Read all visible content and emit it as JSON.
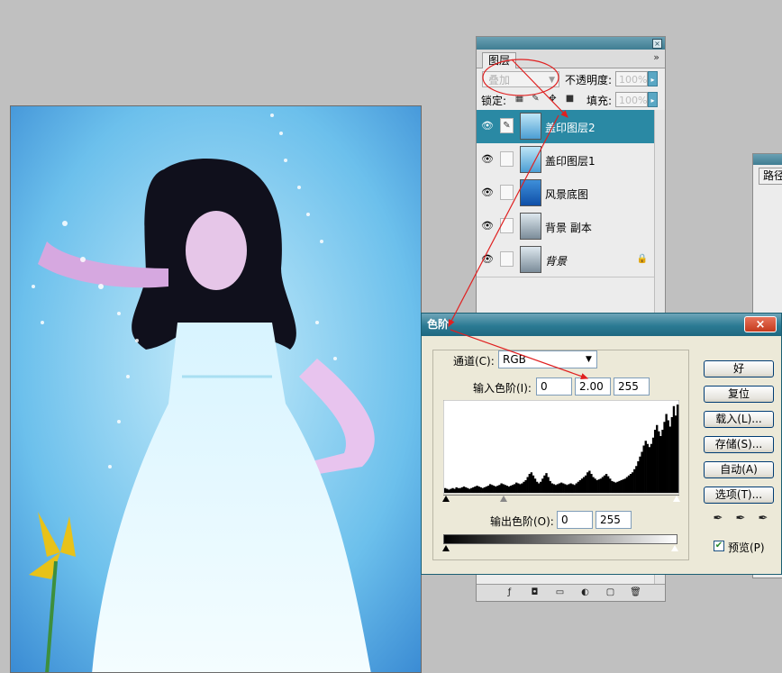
{
  "layers_panel": {
    "tab_label": "图层",
    "menu_glyph": "»",
    "close_glyph": "×",
    "blend_mode": "叠加",
    "opacity_label": "不透明度:",
    "opacity_value": "100%",
    "lock_label": "锁定:",
    "fill_label": "填充:",
    "fill_value": "100%",
    "layers": [
      {
        "name": "盖印图层2",
        "selected": true,
        "visible": true,
        "locked": false,
        "italic": false
      },
      {
        "name": "盖印图层1",
        "selected": false,
        "visible": true,
        "locked": false,
        "italic": false
      },
      {
        "name": "风景底图",
        "selected": false,
        "visible": true,
        "locked": false,
        "italic": false
      },
      {
        "name": "背景 副本",
        "selected": false,
        "visible": true,
        "locked": false,
        "italic": false
      },
      {
        "name": "背景",
        "selected": false,
        "visible": true,
        "locked": true,
        "italic": true
      }
    ]
  },
  "paths_panel": {
    "tab_label": "路径"
  },
  "levels_dialog": {
    "title": "色阶",
    "close_glyph": "×",
    "channel_label": "通道(C):",
    "channel_value": "RGB",
    "input_label": "输入色阶(I):",
    "input_black": "0",
    "input_gamma": "2.00",
    "input_white": "255",
    "output_label": "输出色阶(O):",
    "output_black": "0",
    "output_white": "255",
    "buttons": {
      "ok": "好",
      "reset": "复位",
      "load": "载入(L)...",
      "save": "存储(S)...",
      "auto": "自动(A)",
      "options": "选项(T)..."
    },
    "preview_label": "预览(P)",
    "preview_checked": true,
    "histogram": [
      6,
      5,
      4,
      5,
      6,
      5,
      7,
      6,
      6,
      7,
      8,
      7,
      6,
      5,
      6,
      7,
      8,
      9,
      8,
      7,
      6,
      7,
      8,
      9,
      11,
      10,
      9,
      8,
      9,
      10,
      12,
      11,
      10,
      9,
      8,
      9,
      10,
      11,
      13,
      12,
      11,
      12,
      14,
      16,
      20,
      24,
      26,
      22,
      18,
      14,
      12,
      14,
      18,
      22,
      25,
      20,
      15,
      12,
      11,
      10,
      11,
      12,
      13,
      12,
      11,
      10,
      11,
      12,
      11,
      10,
      12,
      14,
      16,
      18,
      20,
      22,
      26,
      28,
      24,
      20,
      18,
      16,
      17,
      18,
      20,
      22,
      24,
      21,
      18,
      15,
      14,
      13,
      14,
      15,
      16,
      17,
      18,
      20,
      22,
      24,
      26,
      30,
      34,
      40,
      46,
      52,
      60,
      66,
      62,
      58,
      62,
      70,
      80,
      86,
      78,
      72,
      80,
      90,
      100,
      92,
      84,
      96,
      110,
      98,
      112
    ]
  },
  "colors": {
    "desktop": "#c0c0c0",
    "selection": "#2a89a4",
    "dialog_title": "#2b7a93",
    "annotation": "#e02020"
  },
  "icons": {
    "eye": "eye-icon",
    "brush": "brush-icon",
    "lock": "lock-icon",
    "eyedropper": "eyedropper-icon"
  }
}
